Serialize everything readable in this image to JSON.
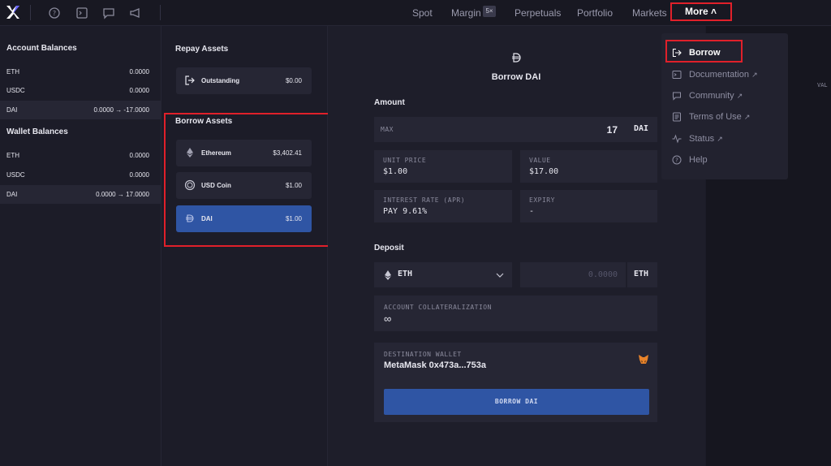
{
  "nav": {
    "items": [
      "Spot",
      "Margin",
      "Perpetuals",
      "Portfolio",
      "Markets"
    ],
    "margin_badge": "5×",
    "more_label": "More ˄"
  },
  "left": {
    "account_title": "Account Balances",
    "account_rows": [
      {
        "asset": "ETH",
        "value": "0.0000"
      },
      {
        "asset": "USDC",
        "value": "0.0000"
      },
      {
        "asset": "DAI",
        "value": "0.0000 → -17.0000"
      }
    ],
    "wallet_title": "Wallet Balances",
    "wallet_rows": [
      {
        "asset": "ETH",
        "value": "0.0000"
      },
      {
        "asset": "USDC",
        "value": "0.0000"
      },
      {
        "asset": "DAI",
        "value": "0.0000 → 17.0000"
      }
    ]
  },
  "middle": {
    "repay_title": "Repay Assets",
    "outstanding": {
      "label": "Outstanding",
      "value": "$0.00"
    },
    "borrow_title": "Borrow Assets",
    "borrow_items": [
      {
        "label": "Ethereum",
        "value": "$3,402.41"
      },
      {
        "label": "USD Coin",
        "value": "$1.00"
      },
      {
        "label": "DAI",
        "value": "$1.00"
      }
    ]
  },
  "main": {
    "title": "Borrow DAI",
    "amount_label": "Amount",
    "max_label": "MAX",
    "amount_value": "17",
    "amount_unit": "DAI",
    "unit_price_label": "UNIT PRICE",
    "unit_price_value": "$1.00",
    "value_label": "VALUE",
    "value_value": "$17.00",
    "interest_label": "INTEREST RATE (APR)",
    "interest_value": "PAY 9.61%",
    "expiry_label": "EXPIRY",
    "expiry_value": "-",
    "deposit_label": "Deposit",
    "deposit_asset": "ETH",
    "deposit_placeholder": "0.0000",
    "deposit_unit": "ETH",
    "collat_label": "ACCOUNT COLLATERALIZATION",
    "collat_value": "∞",
    "dest_label": "DESTINATION WALLET",
    "dest_value": "MetaMask 0x473a...753a",
    "button_label": "BORROW DAI"
  },
  "right_partial": "VAL",
  "dropdown": {
    "items": [
      {
        "label": "Borrow",
        "external": false
      },
      {
        "label": "Documentation",
        "external": true
      },
      {
        "label": "Community",
        "external": true
      },
      {
        "label": "Terms of Use",
        "external": true
      },
      {
        "label": "Status",
        "external": true
      },
      {
        "label": "Help",
        "external": false
      }
    ]
  },
  "colors": {
    "accent": "#2f55a4",
    "highlight": "#e0202a",
    "background": "#1c1c28"
  }
}
